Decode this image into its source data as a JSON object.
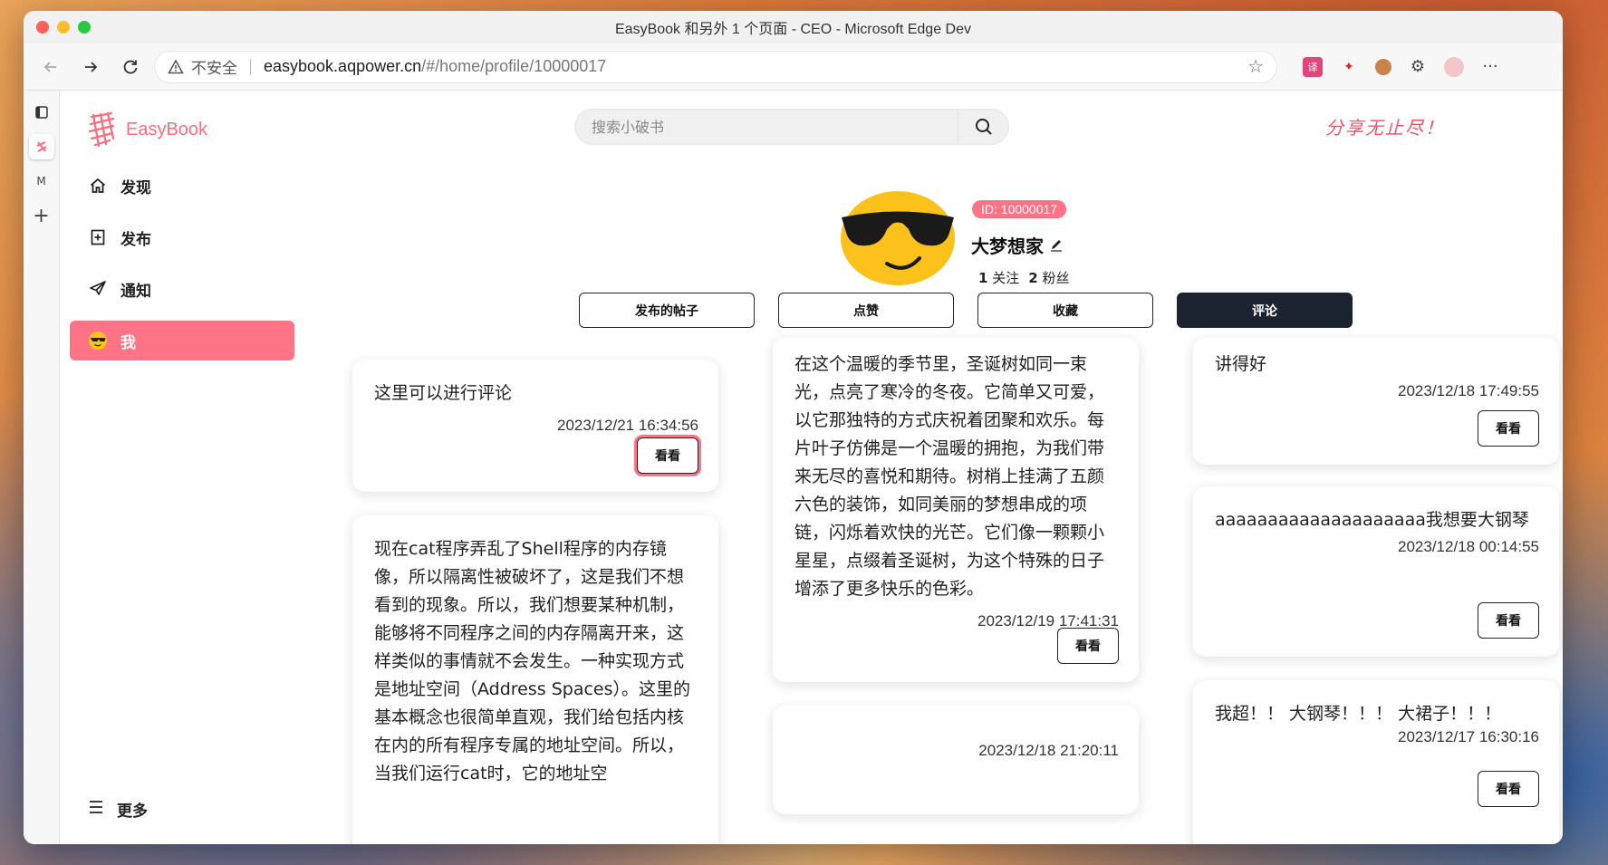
{
  "window": {
    "title": "EasyBook 和另外 1 个页面 - CEO - Microsoft Edge Dev"
  },
  "addressbar": {
    "security_label": "不安全",
    "url_host": "easybook.aqpower.cn",
    "url_path": "/#/home/profile/10000017"
  },
  "icons": {
    "back": "back-arrow-icon",
    "forward": "forward-arrow-icon",
    "reload": "reload-icon",
    "star": "star-icon",
    "more": "more-dots-icon"
  },
  "tabstrip": {
    "items": [
      "tab-actions",
      "EasyBook",
      "M",
      "+"
    ]
  },
  "brand": {
    "name": "EasyBook",
    "slogan": "分享无止尽！",
    "accent": "#fe7386"
  },
  "sidebar": {
    "items": [
      {
        "label": "发现",
        "icon": "home-icon"
      },
      {
        "label": "发布",
        "icon": "publish-icon"
      },
      {
        "label": "通知",
        "icon": "paper-plane-icon"
      },
      {
        "label": "我",
        "icon": "sunglasses-emoji-icon"
      }
    ],
    "more_label": "更多"
  },
  "search": {
    "placeholder": "搜索小破书"
  },
  "profile": {
    "id_badge": "ID: 10000017",
    "name": "大梦想家",
    "following_count": "1",
    "following_label": "关注",
    "followers_count": "2",
    "followers_label": "粉丝"
  },
  "tabs": [
    {
      "label": "发布的帖子",
      "active": false
    },
    {
      "label": "点赞",
      "active": false
    },
    {
      "label": "收藏",
      "active": false
    },
    {
      "label": "评论",
      "active": true
    }
  ],
  "view_label": "看看",
  "comments": [
    {
      "text": "这里可以进行评论",
      "date": "2023/12/21 16:34:56"
    },
    {
      "text": "现在cat程序弄乱了Shell程序的内存镜像，所以隔离性被破坏了，这是我们不想看到的现象。所以，我们想要某种机制，能够将不同程序之间的内存隔离开来，这样类似的事情就不会发生。一种实现方式是地址空间（Address Spaces）。这里的基本概念也很简单直观，我们给包括内核在内的所有程序专属的地址空间。所以，当我们运行cat时，它的地址空",
      "date": ""
    },
    {
      "text": "在这个温暖的季节里，圣诞树如同一束光，点亮了寒冷的冬夜。它简单又可爱，以它那独特的方式庆祝着团聚和欢乐。每片叶子仿佛是一个温暖的拥抱，为我们带来无尽的喜悦和期待。树梢上挂满了五颜六色的装饰，如同美丽的梦想串成的项链，闪烁着欢快的光芒。它们像一颗颗小星星，点缀着圣诞树，为这个特殊的日子增添了更多快乐的色彩。",
      "date": "2023/12/19 17:41:31"
    },
    {
      "text": "",
      "date": "2023/12/18 21:20:11"
    },
    {
      "text": "讲得好",
      "date": "2023/12/18 17:49:55"
    },
    {
      "text": "aaaaaaaaaaaaaaaaaaaa我想要大钢琴",
      "date": "2023/12/18 00:14:55"
    },
    {
      "text": "我超！！ 大钢琴！！！ 大裙子！！！",
      "date": "2023/12/17 16:30:16"
    }
  ]
}
